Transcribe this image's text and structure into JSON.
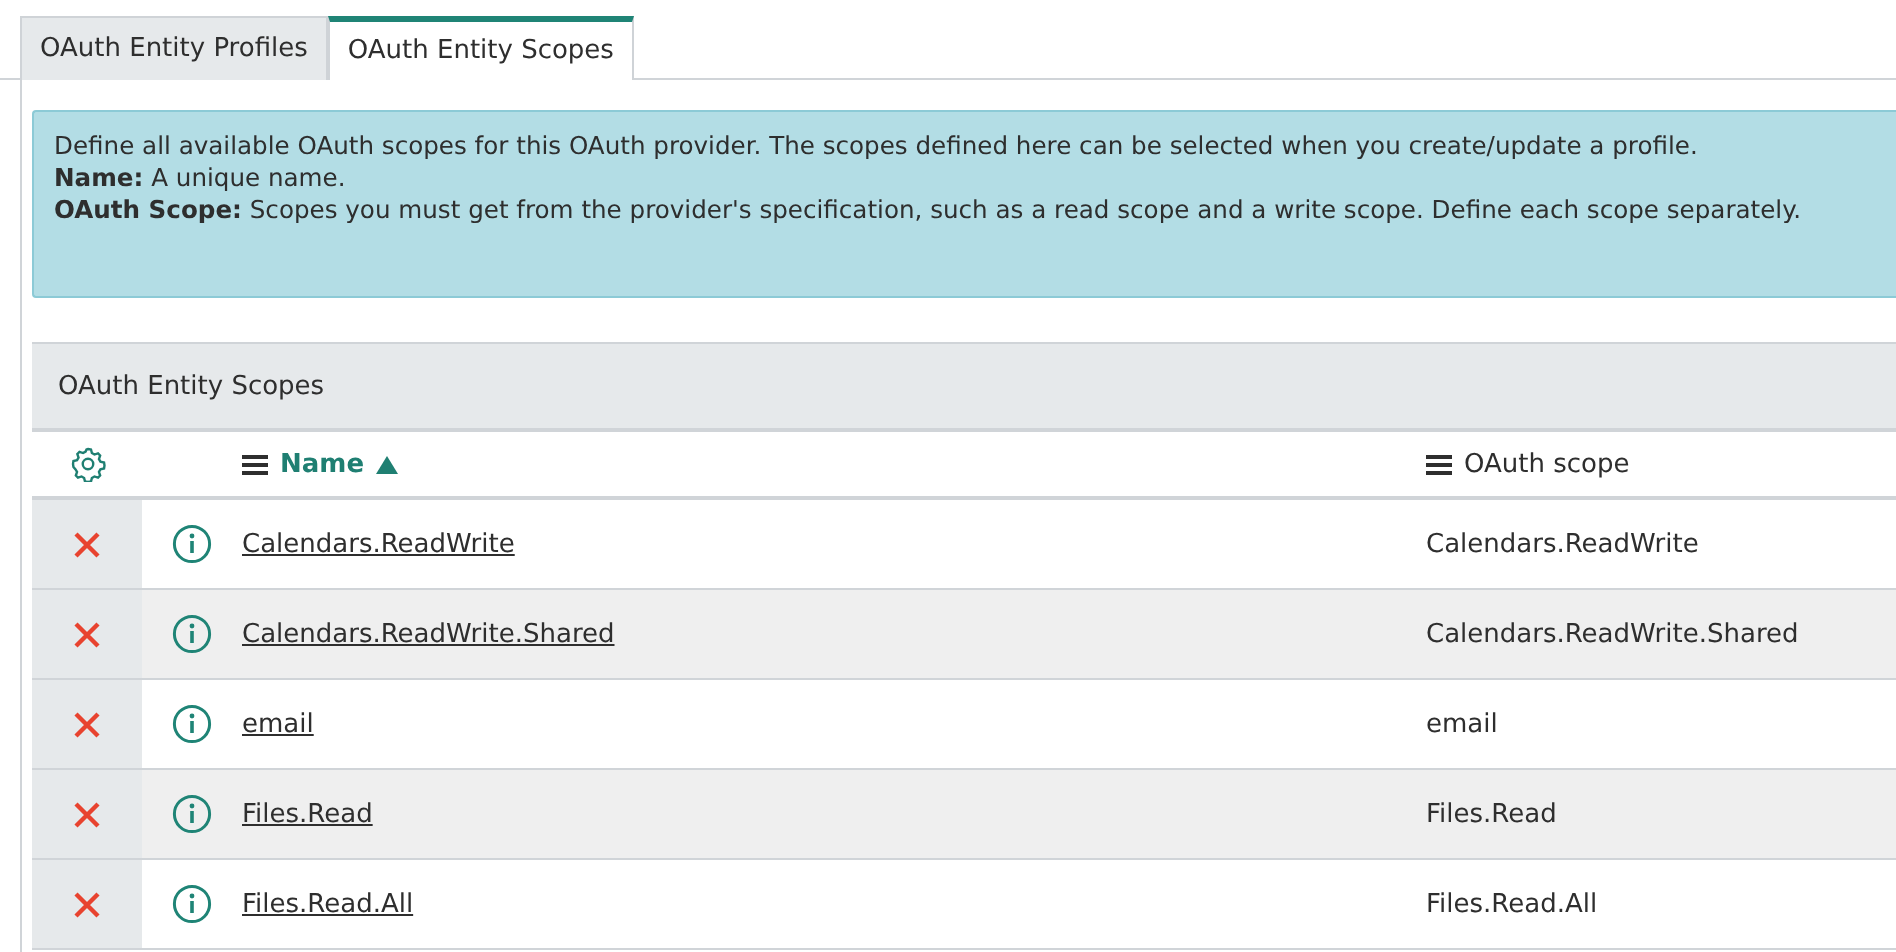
{
  "tabs": [
    {
      "label": "OAuth Entity Profiles",
      "selected": false
    },
    {
      "label": "OAuth Entity Scopes",
      "selected": true
    }
  ],
  "info": [
    "Define all available OAuth scopes for this OAuth provider. The scopes defined here can be selected when you create/update a profile.",
    "**Name:** A unique name.",
    "**OAuth Scope:** Scopes you must get from the provider's specification, such as a read scope and a write scope. Define each scope separately."
  ],
  "list": {
    "title": "OAuth Entity Scopes",
    "columns": [
      {
        "label": "Name",
        "sorted": true
      },
      {
        "label": "OAuth scope",
        "sorted": false
      }
    ],
    "rows": [
      {
        "name": "Calendars.ReadWrite",
        "oauth_scope": "Calendars.ReadWrite"
      },
      {
        "name": "Calendars.ReadWrite.Shared",
        "oauth_scope": "Calendars.ReadWrite.Shared"
      },
      {
        "name": "email",
        "oauth_scope": "email"
      },
      {
        "name": "Files.Read",
        "oauth_scope": "Files.Read"
      },
      {
        "name": "Files.Read.All",
        "oauth_scope": "Files.Read.All"
      }
    ]
  }
}
